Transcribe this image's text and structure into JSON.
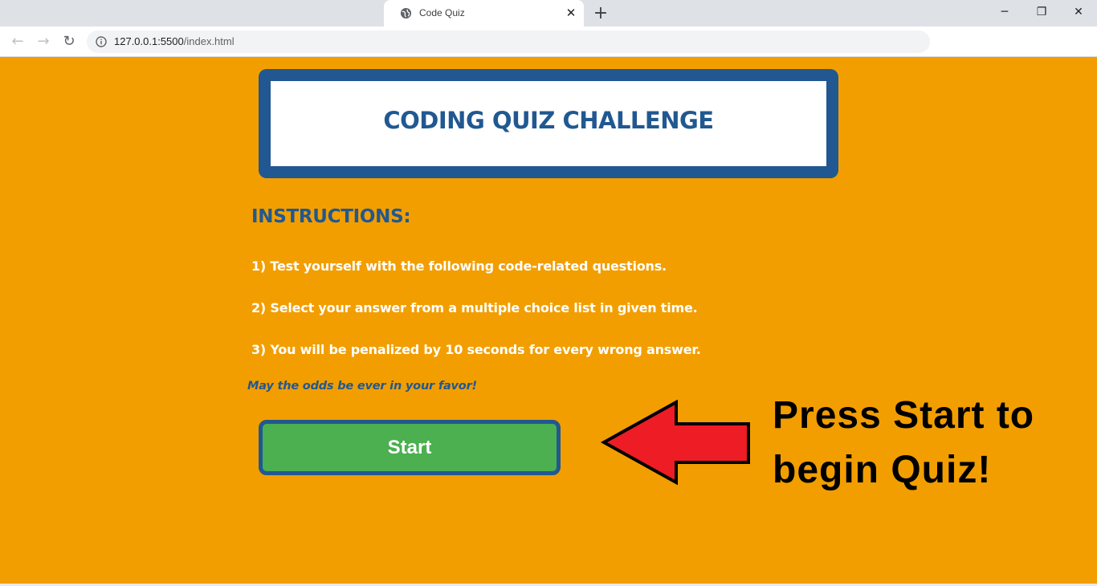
{
  "browser": {
    "tab_title": "Code Quiz",
    "tab_close": "✕",
    "new_tab": "+",
    "window_controls": {
      "minimize": "─",
      "restore": "❐",
      "close": "✕"
    },
    "nav": {
      "back": "←",
      "forward": "→",
      "reload": "↻"
    },
    "url_host": "127.0.0.1:5500",
    "url_path": "/index.html"
  },
  "header": {
    "title": "CODING QUIZ CHALLENGE"
  },
  "instructions": {
    "heading": "INSTRUCTIONS:",
    "items": [
      "1) Test yourself with the following code-related questions.",
      "2) Select your answer from a multiple choice list in given time.",
      "3) You will be penalized by 10 seconds for every wrong answer."
    ],
    "tagline": "May the odds be ever in your favor!"
  },
  "start_button": {
    "label": "Start"
  },
  "callout": {
    "line1": "Press Start to",
    "line2": "begin Quiz!"
  },
  "colors": {
    "page_bg": "#f29e00",
    "brand_blue": "#215891",
    "start_green": "#4caf50",
    "arrow_red": "#ee1c25"
  },
  "icons": {
    "tab_favicon": "globe-icon",
    "site_info": "info-icon",
    "pointer": "left-arrow-icon"
  }
}
